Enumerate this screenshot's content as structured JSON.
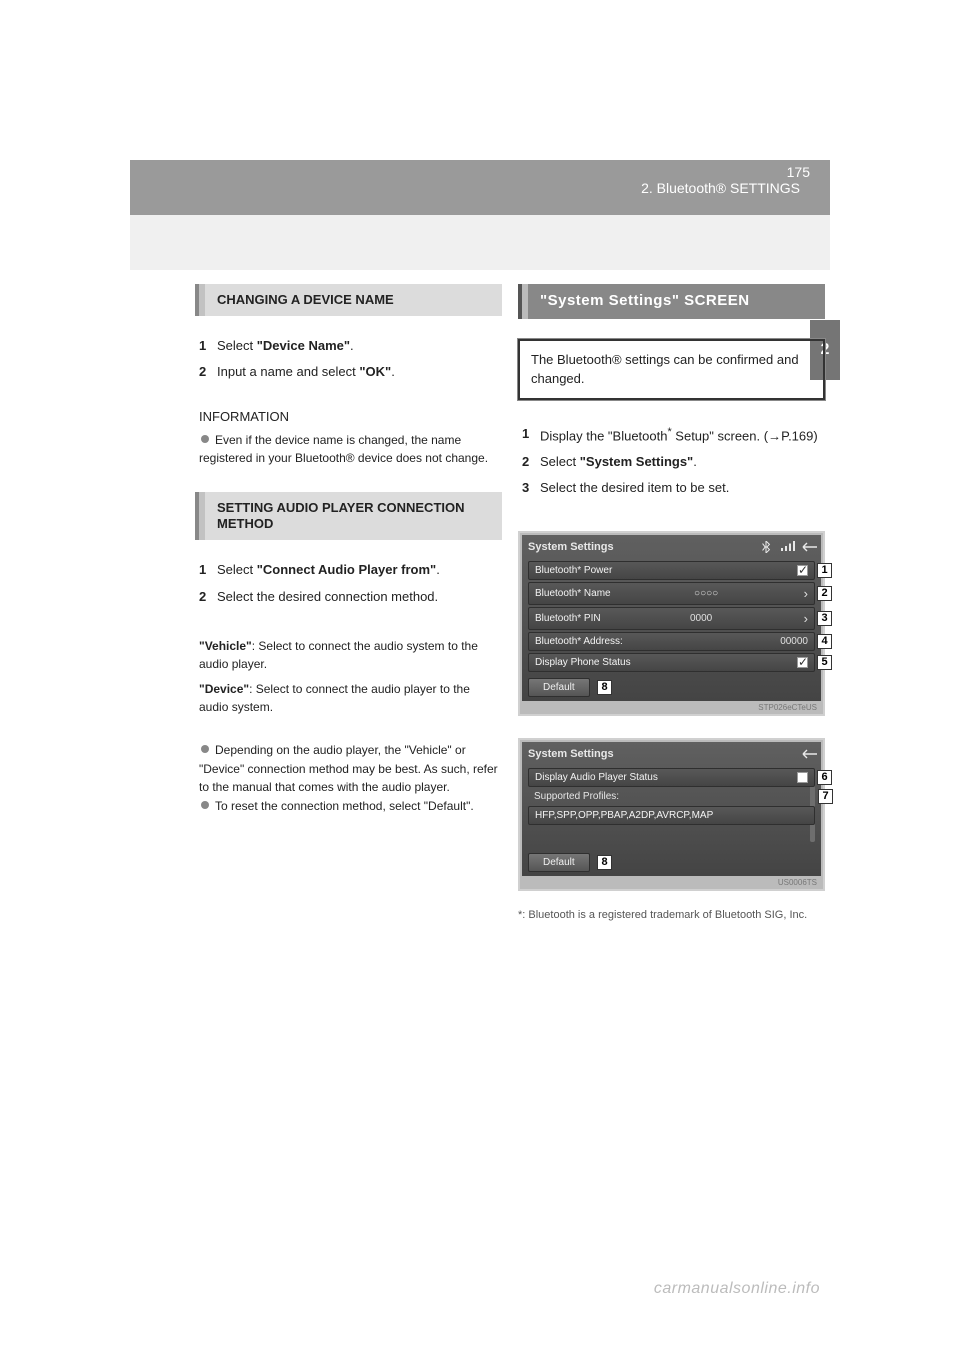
{
  "header": {
    "crumb": "2. Bluetooth® SETTINGS",
    "page_number": "175"
  },
  "sidetab": {
    "num": "2"
  },
  "left": {
    "section_a_title": "CHANGING A DEVICE NAME",
    "steps_a": [
      {
        "n": "1",
        "text_pre": "Select ",
        "bold": "\"Device Name\"",
        "text_post": "."
      },
      {
        "n": "2",
        "text_pre": "Input a name and select ",
        "bold": "\"OK\"",
        "text_post": "."
      }
    ],
    "info_heading": "INFORMATION",
    "info_bullet": "Even if the device name is changed, the name registered in your Bluetooth® device does not change.",
    "section_b_title": "SETTING AUDIO PLAYER CONNECTION METHOD",
    "steps_b": [
      {
        "n": "1",
        "text_pre": "Select ",
        "bold": "\"Connect Audio Player from\"",
        "text_post": "."
      },
      {
        "n": "2",
        "text_pre": "Select the desired connection method.",
        "bold": "",
        "text_post": ""
      }
    ],
    "methods": [
      {
        "label": "\"Vehicle\"",
        "desc": ": Select to connect the audio system to the audio player."
      },
      {
        "label": "\"Device\"",
        "desc": ": Select to connect the audio player to the audio system."
      }
    ],
    "notes": [
      "Depending on the audio player, the \"Vehicle\" or \"Device\" connection method may be best. As such, refer to the manual that comes with the audio player.",
      "To reset the connection method, select \"Default\"."
    ]
  },
  "right": {
    "header_title": "\"System Settings\" SCREEN",
    "box_text": "The Bluetooth® settings can be confirmed and changed.",
    "displaying_steps": [
      {
        "n": "1",
        "parts": [
          "Display the \"Bluetooth",
          "*",
          " Setup\" screen. (→P.169)"
        ]
      },
      {
        "n": "2",
        "text_pre": "Select ",
        "bold": "\"System Settings\"",
        "text_post": "."
      },
      {
        "n": "3",
        "text_pre": "Select the desired item to be set.",
        "bold": "",
        "text_post": ""
      }
    ],
    "screen1": {
      "title": "System Settings",
      "rows": [
        {
          "label": "Bluetooth* Power",
          "value": "",
          "check": true,
          "callout": "1"
        },
        {
          "label": "Bluetooth* Name",
          "value": "○○○○",
          "arrow": true,
          "callout": "2"
        },
        {
          "label": "Bluetooth* PIN",
          "value": "0000",
          "arrow": true,
          "callout": "3"
        },
        {
          "label": "Bluetooth* Address:",
          "value": "00000",
          "callout": "4"
        },
        {
          "label": "Display Phone Status",
          "value": "",
          "check": true,
          "callout": "5"
        }
      ],
      "default_label": "Default",
      "default_callout": "8",
      "code": "STP026eCTeUS"
    },
    "screen2": {
      "title": "System Settings",
      "rows": [
        {
          "label": "Display Audio Player Status",
          "value": "",
          "check": false,
          "callout": "6"
        },
        {
          "label": "Supported Profiles:",
          "plain": true,
          "callout": "7"
        },
        {
          "label": "HFP,SPP,OPP,PBAP,A2DP,AVRCP,MAP",
          "plain": true
        }
      ],
      "default_label": "Default",
      "default_callout": "8",
      "code": "US0006TS"
    },
    "footnote": "*: Bluetooth is a registered trademark of Bluetooth SIG, Inc."
  },
  "watermark": "carmanualsonline.info"
}
